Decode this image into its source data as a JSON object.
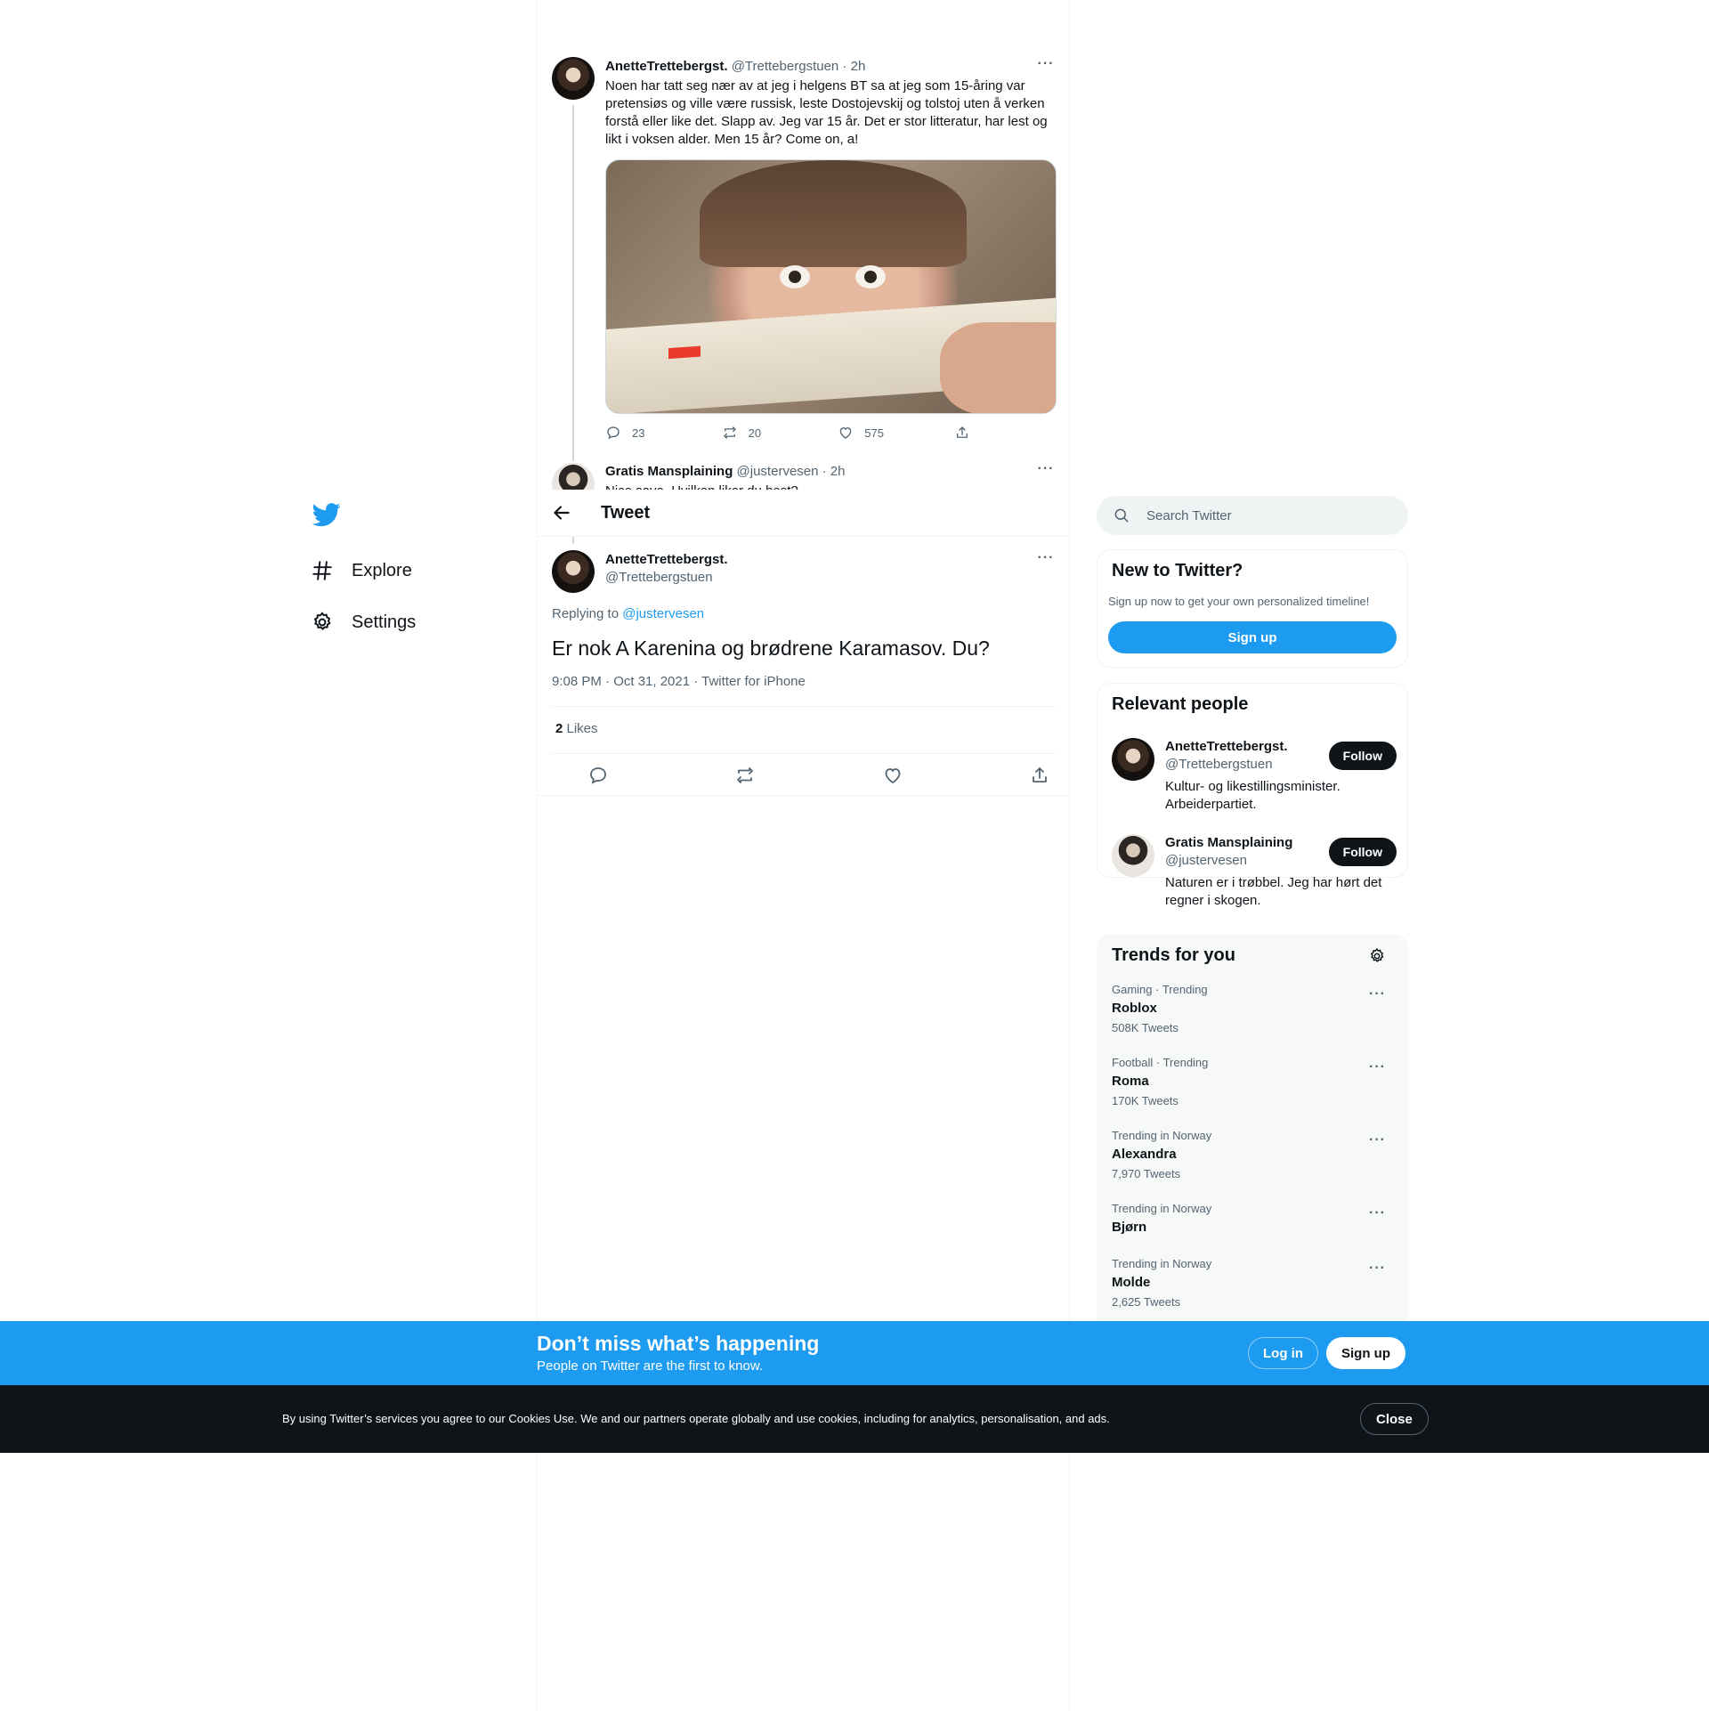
{
  "nav": {
    "explore": "Explore",
    "settings": "Settings"
  },
  "header": {
    "title": "Tweet"
  },
  "thread": [
    {
      "name": "AnetteTrettebergst.",
      "handle": "@Trettebergstuen · 2h",
      "text": "Noen har tatt seg nær av at jeg i helgens BT sa at jeg som 15-åring var pretensiøs og ville være russisk, leste Dostojevskij og tolstoj uten å verken forstå eller like det. Slapp av. Jeg var 15 år. Det er stor litteratur, har lest og likt i voksen alder. Men 15 år? Come on, a!",
      "replies": "23",
      "retweets": "20",
      "likes": "575"
    },
    {
      "name": "Gratis Mansplaining",
      "handle": "@justervesen · 2h",
      "text": "Nice save. Hvilken liker du best?"
    }
  ],
  "main_tweet": {
    "name": "AnetteTrettebergst.",
    "handle": "@Trettebergstuen",
    "replying_prefix": "Replying to ",
    "replying_to": "@justervesen",
    "text": "Er nok A Karenina og brødrene Karamasov. Du?",
    "timestamp": "9:08 PM · Oct 31, 2021 · Twitter for iPhone",
    "likes_count": "2",
    "likes_label": " Likes"
  },
  "search": {
    "placeholder": "Search Twitter"
  },
  "new_to_twitter": {
    "title": "New to Twitter?",
    "subtitle": "Sign up now to get your own personalized timeline!",
    "button": "Sign up"
  },
  "relevant_people": {
    "title": "Relevant people",
    "people": [
      {
        "name": "AnetteTrettebergst.",
        "handle": "@Trettebergstuen",
        "bio": "Kultur- og likestillingsminister. Arbeiderpartiet.",
        "button": "Follow"
      },
      {
        "name": "Gratis Mansplaining",
        "handle": "@justervesen",
        "bio": "Naturen er i trøbbel. Jeg har hørt det regner i skogen.",
        "button": "Follow"
      }
    ]
  },
  "trends": {
    "title": "Trends for you",
    "items": [
      {
        "category": "Gaming · Trending",
        "name": "Roblox",
        "count": "508K Tweets"
      },
      {
        "category": "Football · Trending",
        "name": "Roma",
        "count": "170K Tweets"
      },
      {
        "category": "Trending in Norway",
        "name": "Alexandra",
        "count": "7,970 Tweets"
      },
      {
        "category": "Trending in Norway",
        "name": "Bjørn",
        "count": ""
      },
      {
        "category": "Trending in Norway",
        "name": "Molde",
        "count": "2,625 Tweets"
      }
    ]
  },
  "banner": {
    "title": "Don’t miss what’s happening",
    "subtitle": "People on Twitter are the first to know.",
    "login": "Log in",
    "signup": "Sign up"
  },
  "cookie": {
    "text": "By using Twitter’s services you agree to our Cookies Use. We and our partners operate globally and use cookies, including for analytics, personalisation, and ads.",
    "close": "Close"
  },
  "colors": {
    "accent": "#1d9bf0",
    "text": "#0f1419",
    "secondary": "#536471",
    "cookie_bg": "#0f1419"
  },
  "icons": [
    "twitter-logo-icon",
    "hashtag-icon",
    "gear-icon",
    "back-arrow-icon",
    "reply-icon",
    "retweet-icon",
    "like-icon",
    "share-icon",
    "search-icon",
    "more-icon"
  ]
}
